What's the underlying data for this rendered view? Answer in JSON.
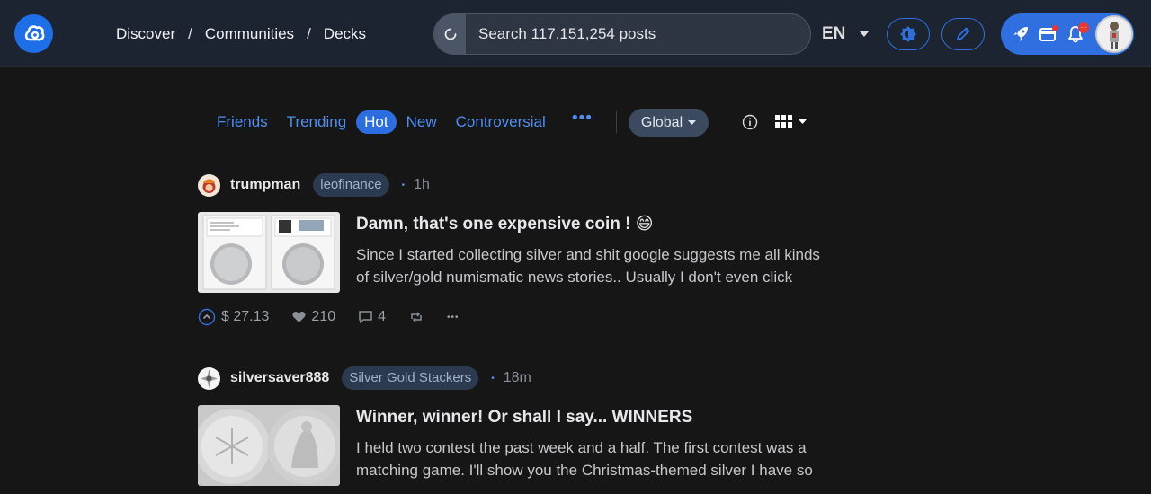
{
  "header": {
    "breadcrumb": [
      "Discover",
      "Communities",
      "Decks"
    ],
    "breadcrumb_sep": "/",
    "search_placeholder": "Search 117,151,254 posts",
    "language": "EN"
  },
  "feed_tabs": {
    "items": [
      "Friends",
      "Trending",
      "Hot",
      "New",
      "Controversial"
    ],
    "active": "Hot",
    "more": "•••",
    "scope": "Global"
  },
  "posts": [
    {
      "author": "trumpman",
      "community": "leofinance",
      "dot": "•",
      "time": "1h",
      "title": "Damn, that's one expensive coin ! 😄",
      "summary": "Since I started collecting silver and shit google suggests me all kinds of silver/gold numismatic news stories.. Usually I don't even click",
      "payout": "$ 27.13",
      "votes": "210",
      "comments": "4",
      "more": "•••"
    },
    {
      "author": "silversaver888",
      "community": "Silver Gold Stackers",
      "dot": "•",
      "time": "18m",
      "title": "Winner, winner! Or shall I say... WINNERS",
      "summary": "I held two contest the past week and a half. The first contest was a matching game. I'll show you the Christmas-themed silver I have so"
    }
  ],
  "colors": {
    "accent": "#2c6de0",
    "link": "#4e8ef0",
    "background": "#161617",
    "header": "#1c2431"
  }
}
